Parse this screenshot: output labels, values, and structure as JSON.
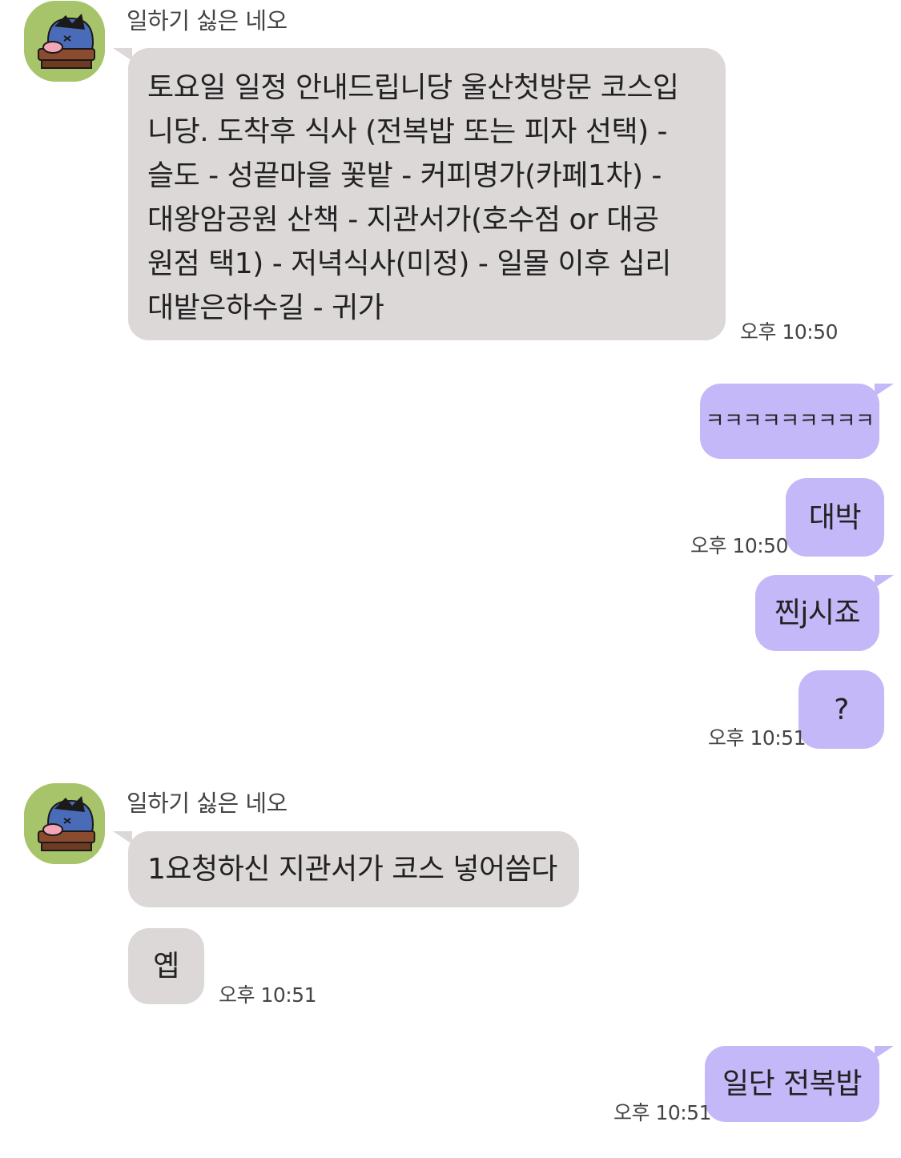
{
  "chat": {
    "sender_name": "일하기 싫은 네오",
    "messages": [
      {
        "from": "them",
        "text_lines": [
          "토요일 일정 안내드립니당 울산첫방문 코스입",
          "니당. 도착후 식사 (전복밥 또는 피자 선택) -",
          "슬도 - 성끝마을 꽃밭 - 커피명가(카페1차) -",
          "대왕암공원 산책 - 지관서가(호수점 or 대공",
          "원점 택1) - 저녁식사(미정) - 일몰 이후 십리",
          "대밭은하수길 - 귀가"
        ],
        "time": "오후 10:50"
      },
      {
        "from": "me",
        "text": "ㅋㅋㅋㅋㅋㅋㅋㅋㅋ"
      },
      {
        "from": "me",
        "text": "대박",
        "time": "오후 10:50"
      },
      {
        "from": "me",
        "text": "찐j시죠"
      },
      {
        "from": "me",
        "text": "?",
        "time": "오후 10:51"
      },
      {
        "from": "them",
        "text": "1요청하신 지관서가 코스 넣어씀다"
      },
      {
        "from": "them",
        "text": "옙",
        "time": "오후 10:51"
      },
      {
        "from": "me",
        "text": "일단 전복밥",
        "time": "오후 10:51"
      }
    ]
  },
  "colors": {
    "incoming_bubble": "#dcd8d8",
    "outgoing_bubble": "#c5b8f8",
    "avatar_bg": "#a7c46a"
  },
  "icons": {
    "avatar": "neo-character-avatar-icon"
  }
}
